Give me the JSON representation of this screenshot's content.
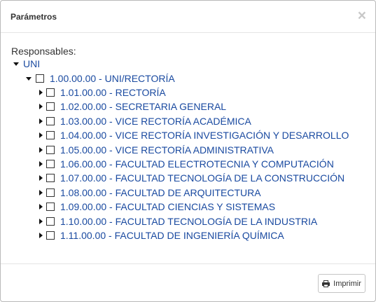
{
  "dialog": {
    "title": "Parámetros",
    "close_glyph": "×"
  },
  "body": {
    "label": "Responsables:",
    "root": {
      "label": "UNI",
      "expanded": true,
      "child": {
        "label": "1.00.00.00 - UNI/RECTORÍA",
        "expanded": true,
        "checked": false,
        "children": [
          {
            "label": "1.01.00.00 - RECTORÍA",
            "expanded": false,
            "checked": false
          },
          {
            "label": "1.02.00.00 - SECRETARIA GENERAL",
            "expanded": false,
            "checked": false
          },
          {
            "label": "1.03.00.00 - VICE RECTORÍA ACADÉMICA",
            "expanded": false,
            "checked": false
          },
          {
            "label": "1.04.00.00 - VICE RECTORÍA INVESTIGACIÓN Y DESARROLLO",
            "expanded": false,
            "checked": false
          },
          {
            "label": "1.05.00.00 - VICE RECTORÍA ADMINISTRATIVA",
            "expanded": false,
            "checked": false
          },
          {
            "label": "1.06.00.00 - FACULTAD ELECTROTECNIA Y COMPUTACIÓN",
            "expanded": false,
            "checked": false
          },
          {
            "label": "1.07.00.00 - FACULTAD TECNOLOGÍA DE LA CONSTRUCCIÓN",
            "expanded": false,
            "checked": false
          },
          {
            "label": "1.08.00.00 - FACULTAD DE ARQUITECTURA",
            "expanded": false,
            "checked": false
          },
          {
            "label": "1.09.00.00 - FACULTAD CIENCIAS Y SISTEMAS",
            "expanded": false,
            "checked": false
          },
          {
            "label": "1.10.00.00 - FACULTAD TECNOLOGÍA DE LA INDUSTRIA",
            "expanded": false,
            "checked": false
          },
          {
            "label": "1.11.00.00 - FACULTAD DE INGENIERÍA QUÍMICA",
            "expanded": false,
            "checked": false
          }
        ]
      }
    }
  },
  "footer": {
    "print_label": "Imprimir",
    "print_icon": "printer-icon"
  },
  "colors": {
    "tree_text": "#1a4aa0",
    "label_text": "#333333"
  }
}
